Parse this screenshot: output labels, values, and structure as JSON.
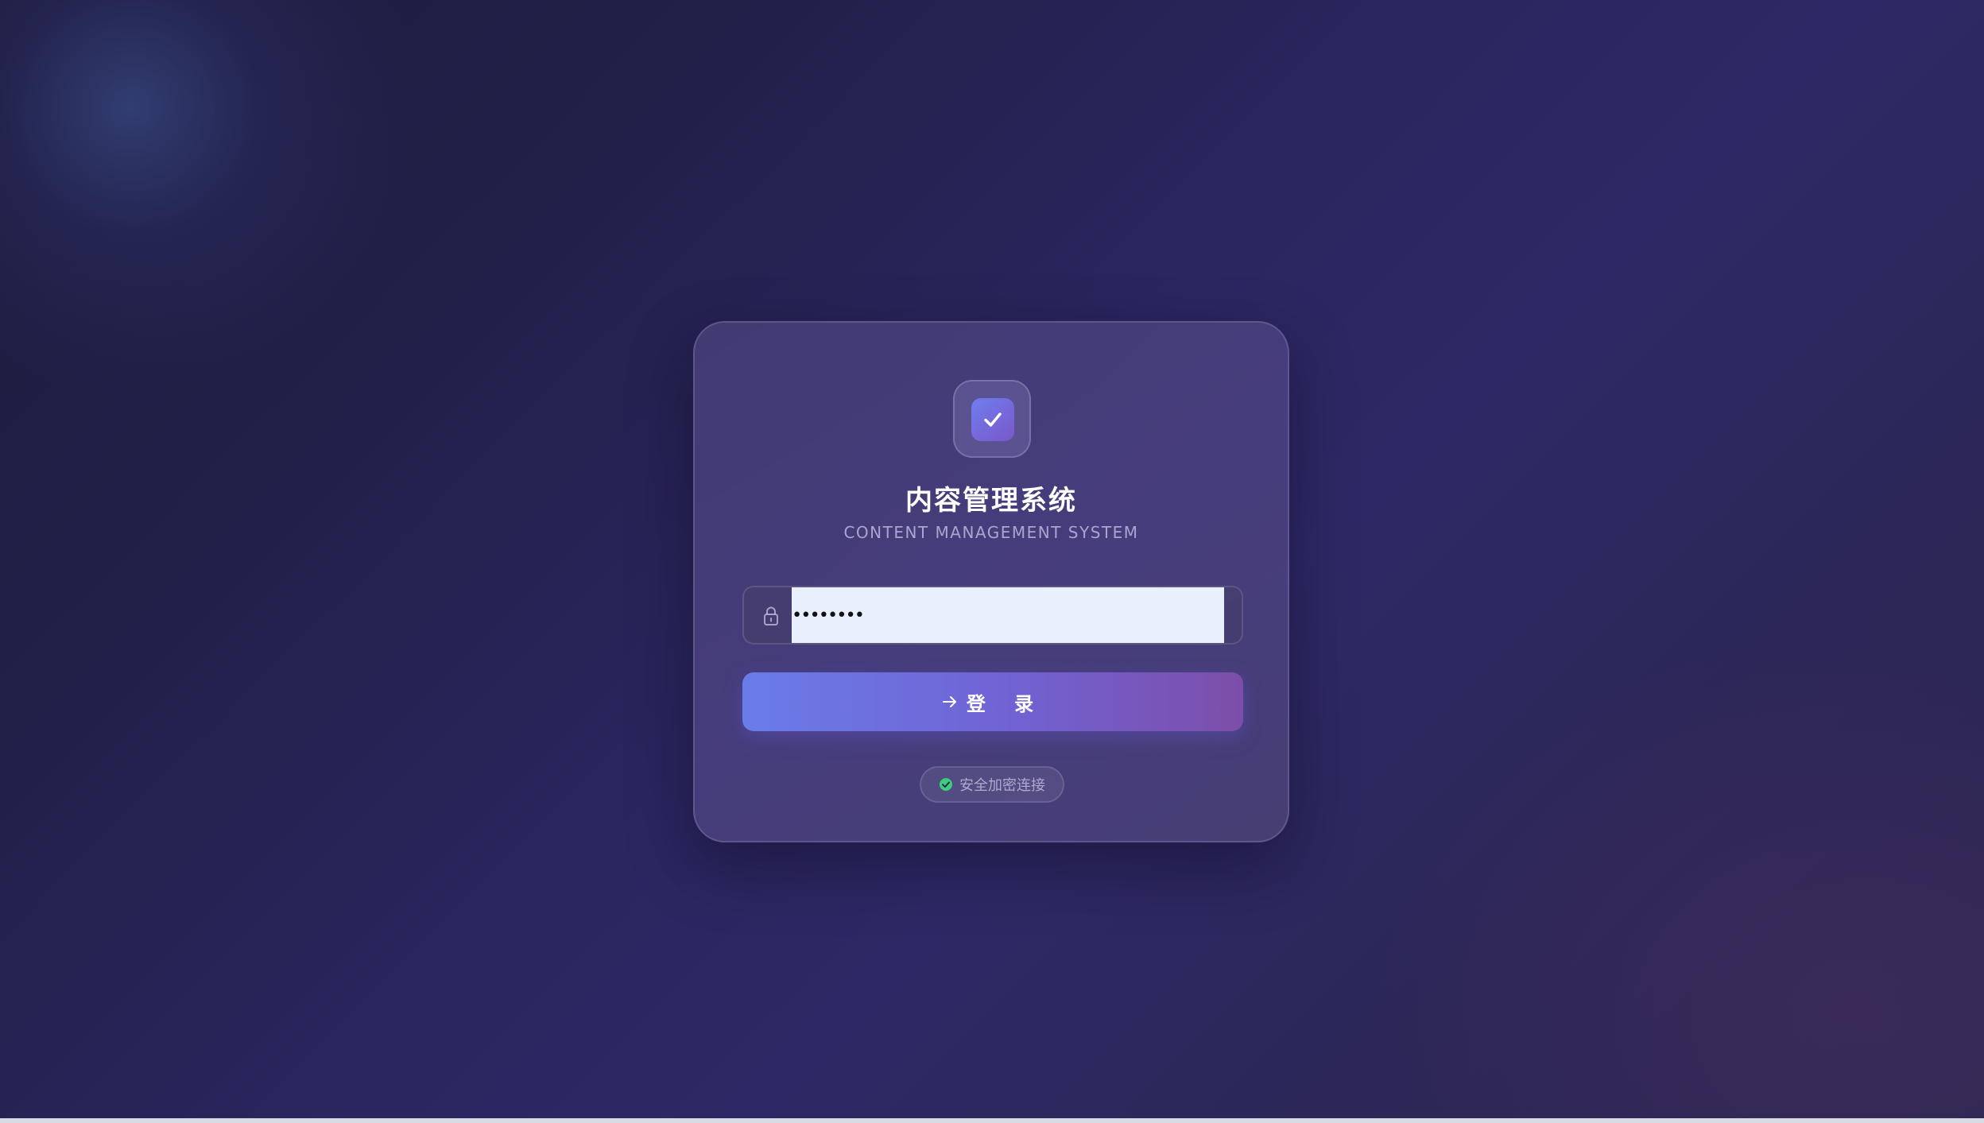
{
  "app": {
    "title": "内容管理系统",
    "subtitle": "CONTENT MANAGEMENT SYSTEM"
  },
  "form": {
    "password_value": "••••••••",
    "login_label": "登 录",
    "secure_text": "安全加密连接"
  },
  "icons": {
    "logo": "check-icon",
    "password": "lock-icon",
    "login": "arrow-right-icon",
    "secure": "check-circle-icon"
  },
  "colors": {
    "accent_start": "#6a7ce8",
    "accent_end": "#7c4ea9",
    "secure_ok": "#3ccf7a"
  }
}
